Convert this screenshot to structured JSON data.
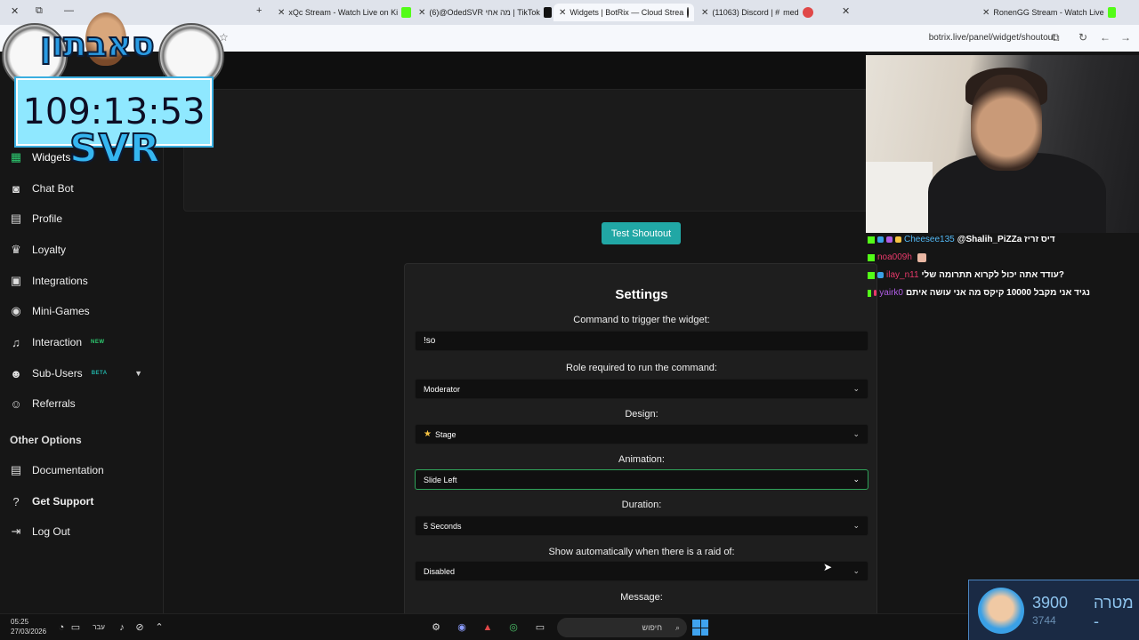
{
  "browser": {
    "tabs": [
      {
        "title": "xQc Stream - Watch Live on Ki",
        "color": "#53fc18"
      },
      {
        "title": "(6)@OdedSVR מה אחי | TikTok",
        "color": "#111111"
      },
      {
        "title": "Widgets | BotRix — Cloud Strea",
        "color": "#ffffff"
      },
      {
        "title": "(11063) Discord | #",
        "extra": "med",
        "color": "#e04848"
      },
      {
        "title": "RonenGG Stream - Watch Live",
        "color": "#53fc18"
      }
    ],
    "url": "botrix.live/panel/widget/shoutout"
  },
  "overlay": {
    "hebrew_title": "סאבתון",
    "timer": "109:13:53",
    "brand": "SVR"
  },
  "sidebar": {
    "items": [
      {
        "label": "Widgets",
        "icon": "grid-icon",
        "glyph": "▦",
        "active": true
      },
      {
        "label": "Chat Bot",
        "icon": "robot-icon",
        "glyph": "◙"
      },
      {
        "label": "Profile",
        "icon": "id-card-icon",
        "glyph": "▤"
      },
      {
        "label": "Loyalty",
        "icon": "trophy-icon",
        "glyph": "♛"
      },
      {
        "label": "Integrations",
        "icon": "plug-icon",
        "glyph": "▣"
      },
      {
        "label": "Mini-Games",
        "icon": "gamepad-icon",
        "glyph": "◉"
      },
      {
        "label": "Interaction",
        "icon": "music-icon",
        "glyph": "♫",
        "badge": "NEW"
      },
      {
        "label": "Sub-Users",
        "icon": "users-icon",
        "glyph": "☻",
        "badge": "BETA"
      },
      {
        "label": "Referrals",
        "icon": "referral-icon",
        "glyph": "☺"
      }
    ],
    "other_title": "Other Options",
    "other": [
      {
        "label": "Documentation",
        "icon": "doc-icon",
        "glyph": "▤"
      },
      {
        "label": "Get Support",
        "icon": "question-icon",
        "glyph": "?"
      },
      {
        "label": "Log Out",
        "icon": "logout-icon",
        "glyph": "⇥"
      }
    ]
  },
  "main": {
    "test_button": "Test Shoutout",
    "settings": {
      "title": "Settings",
      "command_label": "Command to trigger the widget:",
      "command_value": "!so",
      "role_label": "Role required to run the command:",
      "role_value": "Moderator",
      "design_label": "Design:",
      "design_value": "Stage",
      "animation_label": "Animation:",
      "animation_value": "Slide Left",
      "duration_label": "Duration:",
      "duration_value": "5 Seconds",
      "raid_label": "Show automatically when there is a raid of:",
      "raid_value": "Disabled",
      "message_label": "Message:"
    }
  },
  "chat": [
    {
      "user": "Cheesee135",
      "user_color": "#52b8f4",
      "message": "@Shalih_PiZZa דיס זריז"
    },
    {
      "user": "noa009h",
      "user_color": "#e8396a",
      "message": ""
    },
    {
      "user": "ilay_n11",
      "user_color": "#e8396a",
      "message": "עודד אתה יכול לקרוא תתרומה שלי?"
    },
    {
      "user": "yairk0",
      "user_color": "#b05ce6",
      "message": "נגיד אני מקבל 10000 קיקס מה אני עושה איתם"
    }
  ],
  "goal": {
    "value": "3900",
    "label": "מטרה -",
    "sub": "3744"
  },
  "taskbar": {
    "time": "05:25",
    "date": "27/03/2026",
    "lang": "עבר",
    "search": "חיפוש"
  }
}
